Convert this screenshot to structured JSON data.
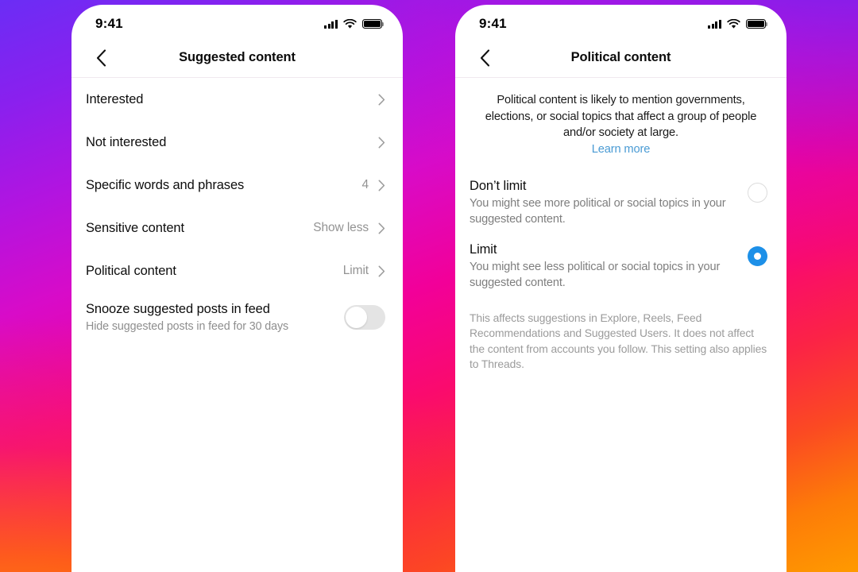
{
  "background": {
    "gradient_colors": [
      "#6b2df5",
      "#b214e0",
      "#f20099",
      "#fb4a22",
      "#ff9a00"
    ]
  },
  "colors": {
    "accent_blue": "#1d90e8",
    "link_blue": "#4a9bd4",
    "muted_text": "#8e8e8e",
    "primary_text": "#0d0d0d",
    "toggle_off_track": "#e4e4e4"
  },
  "status_bar": {
    "time": "9:41",
    "signal_icon": "cellular-signal-icon",
    "wifi_icon": "wifi-icon",
    "battery_icon": "battery-full-icon"
  },
  "left_screen": {
    "back_icon": "chevron-left-icon",
    "title": "Suggested content",
    "rows": [
      {
        "label": "Interested",
        "value": "",
        "chevron": "chevron-right-icon"
      },
      {
        "label": "Not interested",
        "value": "",
        "chevron": "chevron-right-icon"
      },
      {
        "label": "Specific words and phrases",
        "value": "4",
        "chevron": "chevron-right-icon"
      },
      {
        "label": "Sensitive content",
        "value": "Show less",
        "chevron": "chevron-right-icon"
      },
      {
        "label": "Political content",
        "value": "Limit",
        "chevron": "chevron-right-icon"
      }
    ],
    "toggle_row": {
      "title": "Snooze suggested posts in feed",
      "subtitle": "Hide suggested posts in feed for 30 days",
      "state": "off"
    }
  },
  "right_screen": {
    "back_icon": "chevron-left-icon",
    "title": "Political content",
    "description": "Political content is likely to mention governments, elections, or social topics that affect a group of people and/or society at large.",
    "learn_more_label": "Learn more",
    "options": [
      {
        "title": "Don’t limit",
        "subtitle": "You might see more political or social topics in your suggested content.",
        "selected": false
      },
      {
        "title": "Limit",
        "subtitle": "You might see less political or social topics in your suggested content.",
        "selected": true
      }
    ],
    "footnote": "This affects suggestions in Explore, Reels, Feed Recommendations and Suggested Users. It does not affect the content from accounts you follow. This setting also applies to Threads."
  }
}
